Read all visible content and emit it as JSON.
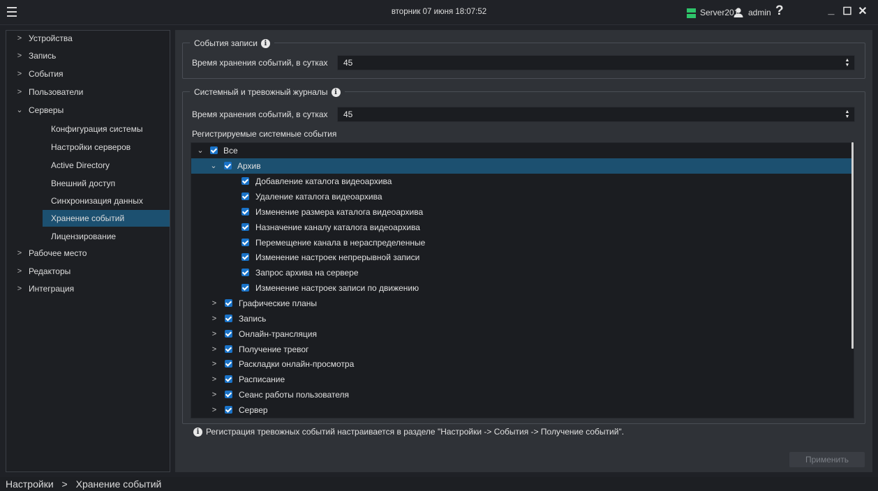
{
  "header": {
    "datetime": "вторник 07 июня 18:07:52",
    "server": "Server201",
    "user": "admin",
    "help": "?",
    "window_controls": {
      "minimize": "_",
      "maximize": "☐",
      "close": "✕"
    },
    "colors": {
      "server_icon": "#2ec46a"
    }
  },
  "sidebar": {
    "items": [
      {
        "label": "Устройства",
        "icon": "chevron-right-icon"
      },
      {
        "label": "Запись",
        "icon": "chevron-right-icon"
      },
      {
        "label": "События",
        "icon": "chevron-right-icon"
      },
      {
        "label": "Пользователи",
        "icon": "chevron-right-icon"
      },
      {
        "label": "Серверы",
        "icon": "chevron-down-icon"
      }
    ],
    "servers_children": [
      "Конфигурация системы",
      "Настройки серверов",
      "Active Directory",
      "Внешний доступ",
      "Синхронизация данных",
      "Хранение событий",
      "Лицензирование"
    ],
    "active": "Хранение событий",
    "items_after": [
      {
        "label": "Рабочее место",
        "icon": "chevron-right-icon"
      },
      {
        "label": "Редакторы",
        "icon": "chevron-right-icon"
      },
      {
        "label": "Интеграция",
        "icon": "chevron-right-icon"
      }
    ],
    "colors": {
      "active_bg": "#1c5070"
    }
  },
  "record_events": {
    "title": "События записи",
    "retention_label": "Время хранения событий, в сутках",
    "retention_value": "45"
  },
  "system_journal": {
    "title": "Системный и тревожный журналы",
    "retention_label": "Время хранения событий, в сутках",
    "retention_value": "45",
    "registered_label": "Регистрируемые системные события"
  },
  "tree": {
    "root": "Все",
    "archive": "Архив",
    "archive_children": [
      "Добавление каталога видеоархива",
      "Удаление каталога видеоархива",
      "Изменение размера каталога видеоархива",
      "Назначение каналу каталога видеоархива",
      "Перемещение канала в нераспределенные",
      "Изменение настроек непрерывной записи",
      "Запрос архива на сервере",
      "Изменение настроек записи по движению"
    ],
    "collapsed_groups": [
      "Графические планы",
      "Запись",
      "Онлайн-трансляция",
      "Получение тревог",
      "Раскладки онлайн-просмотра",
      "Расписание",
      "Сеанс работы пользователя",
      "Сервер"
    ],
    "colors": {
      "checkbox": "#1a73c8",
      "selected_row": "#1c5070"
    }
  },
  "note": "Регистрация тревожных событий настраивается в разделе \"Настройки -> События -> Получение событий\".",
  "apply_button": "Применить",
  "breadcrumb": {
    "root": "Настройки",
    "separator": ">",
    "current": "Хранение событий"
  }
}
